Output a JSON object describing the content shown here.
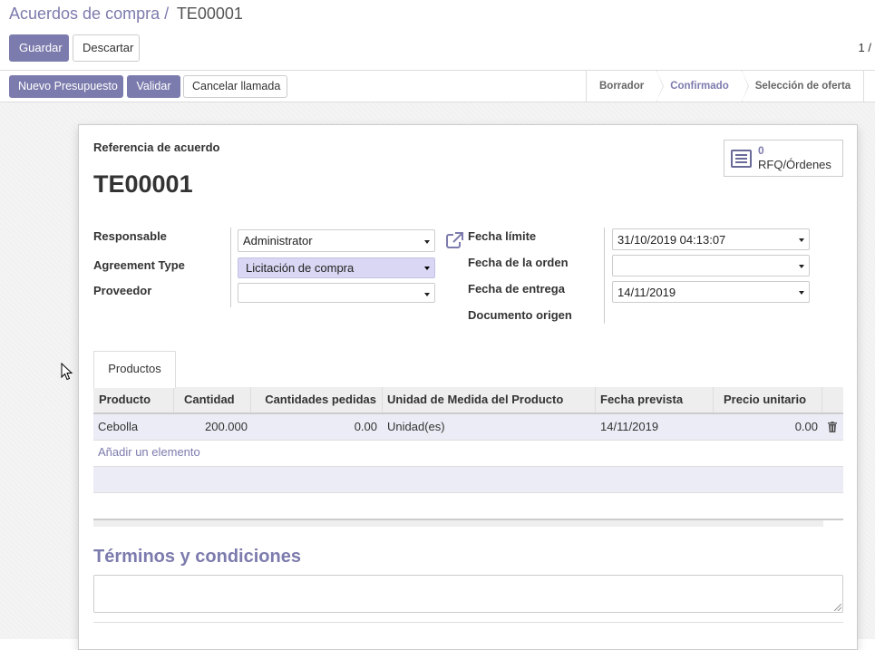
{
  "breadcrumb": {
    "parent": "Acuerdos de compra",
    "separator": "/",
    "current": "TE00001"
  },
  "toolbar": {
    "save_label": "Guardar",
    "discard_label": "Descartar"
  },
  "pager": {
    "value": "1 /"
  },
  "statusbar": {
    "buttons": {
      "new_quote": "Nuevo Presupuesto",
      "validate": "Validar",
      "cancel_call": "Cancelar llamada"
    },
    "stages": [
      {
        "label": "Borrador",
        "active": false
      },
      {
        "label": "Confirmado",
        "active": true
      },
      {
        "label": "Selección de oferta",
        "active": false
      }
    ]
  },
  "form": {
    "ref_label": "Referencia de acuerdo",
    "ref_value": "TE00001",
    "rfq_button": {
      "count": "0",
      "label": "RFQ/Órdenes",
      "icon": "list-icon"
    },
    "left_fields": {
      "responsable": {
        "label": "Responsable",
        "value": "Administrator"
      },
      "agreement_type": {
        "label": "Agreement Type",
        "value": "Licitación de compra"
      },
      "proveedor": {
        "label": "Proveedor",
        "value": ""
      }
    },
    "right_fields": {
      "fecha_limite": {
        "label": "Fecha límite",
        "value": "31/10/2019 04:13:07"
      },
      "fecha_orden": {
        "label": "Fecha de la orden",
        "value": ""
      },
      "fecha_entrega": {
        "label": "Fecha de entrega",
        "value": "14/11/2019"
      },
      "documento_origen": {
        "label": "Documento origen",
        "value": ""
      }
    }
  },
  "notebook": {
    "tab_label": "Productos",
    "columns": {
      "producto": "Producto",
      "cantidad": "Cantidad",
      "cantidades_pedidas": "Cantidades pedidas",
      "uom": "Unidad de Medida del Producto",
      "fecha_prevista": "Fecha prevista",
      "precio_unitario": "Precio unitario"
    },
    "rows": [
      {
        "producto": "Cebolla",
        "cantidad": "200.000",
        "cantidades_pedidas": "0.00",
        "uom": "Unidad(es)",
        "fecha_prevista": "14/11/2019",
        "precio_unitario": "0.00"
      }
    ],
    "add_line_label": "Añadir un elemento"
  },
  "terms": {
    "title": "Términos y condiciones",
    "value": ""
  },
  "colors": {
    "accent": "#7c7bad",
    "highlight_field": "#d9d7f3",
    "row_bg": "#ececf6"
  }
}
